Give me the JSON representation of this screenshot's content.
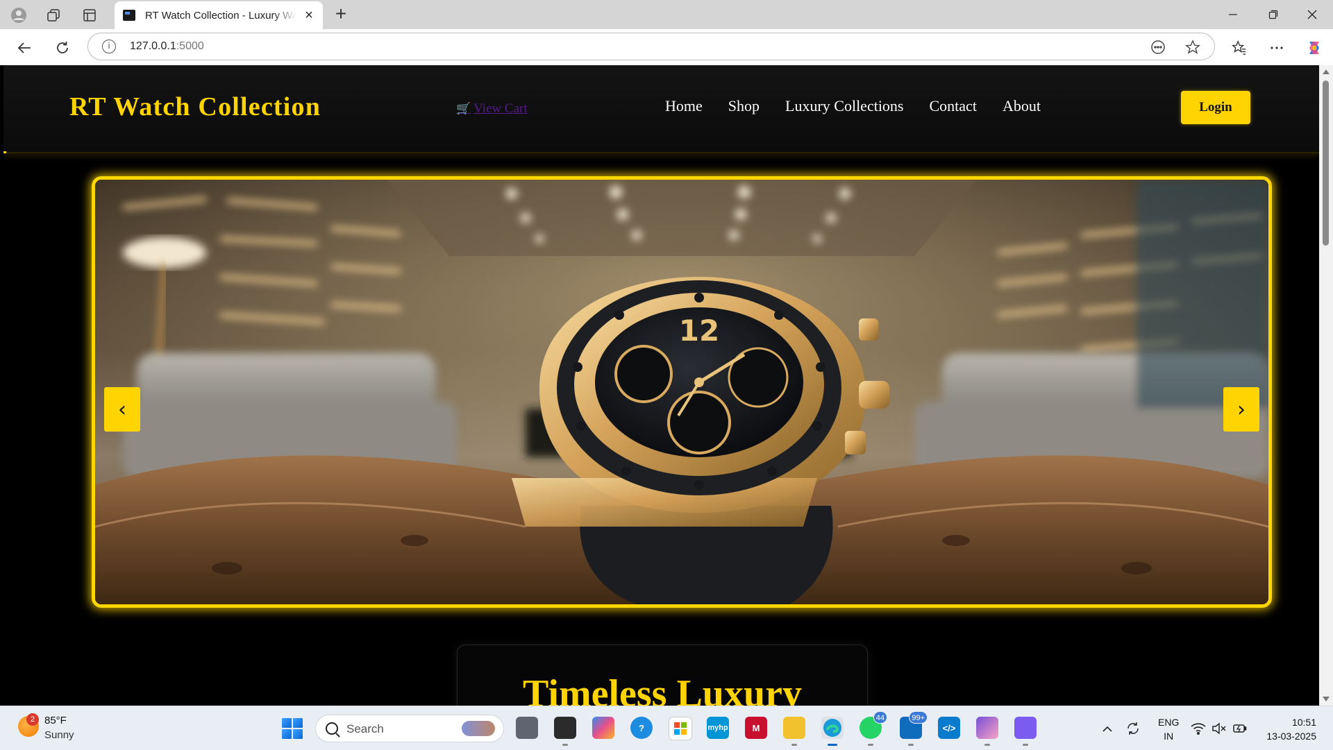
{
  "browser": {
    "tab_title": "RT Watch Collection - Luxury Watches",
    "url_host": "127.0.0.1",
    "url_port": ":5000"
  },
  "site": {
    "brand": "RT Watch Collection",
    "cart_icon": "cart-icon",
    "cart_label": "View Cart",
    "nav": [
      "Home",
      "Shop",
      "Luxury Collections",
      "Contact",
      "About"
    ],
    "login_label": "Login",
    "carousel": {
      "prev_label": "‹",
      "next_label": "›"
    },
    "section_title": "Timeless Luxury"
  },
  "colors": {
    "accent": "#ffd400",
    "background": "#000000",
    "cart_link": "#551a8b"
  },
  "taskbar": {
    "weather_badge": "2",
    "temperature": "85°F",
    "condition": "Sunny",
    "search_placeholder": "Search",
    "whatsapp_badge": "44",
    "mail_badge": "99+",
    "lang_primary": "ENG",
    "lang_region": "IN",
    "time": "10:51",
    "date": "13-03-2025"
  }
}
